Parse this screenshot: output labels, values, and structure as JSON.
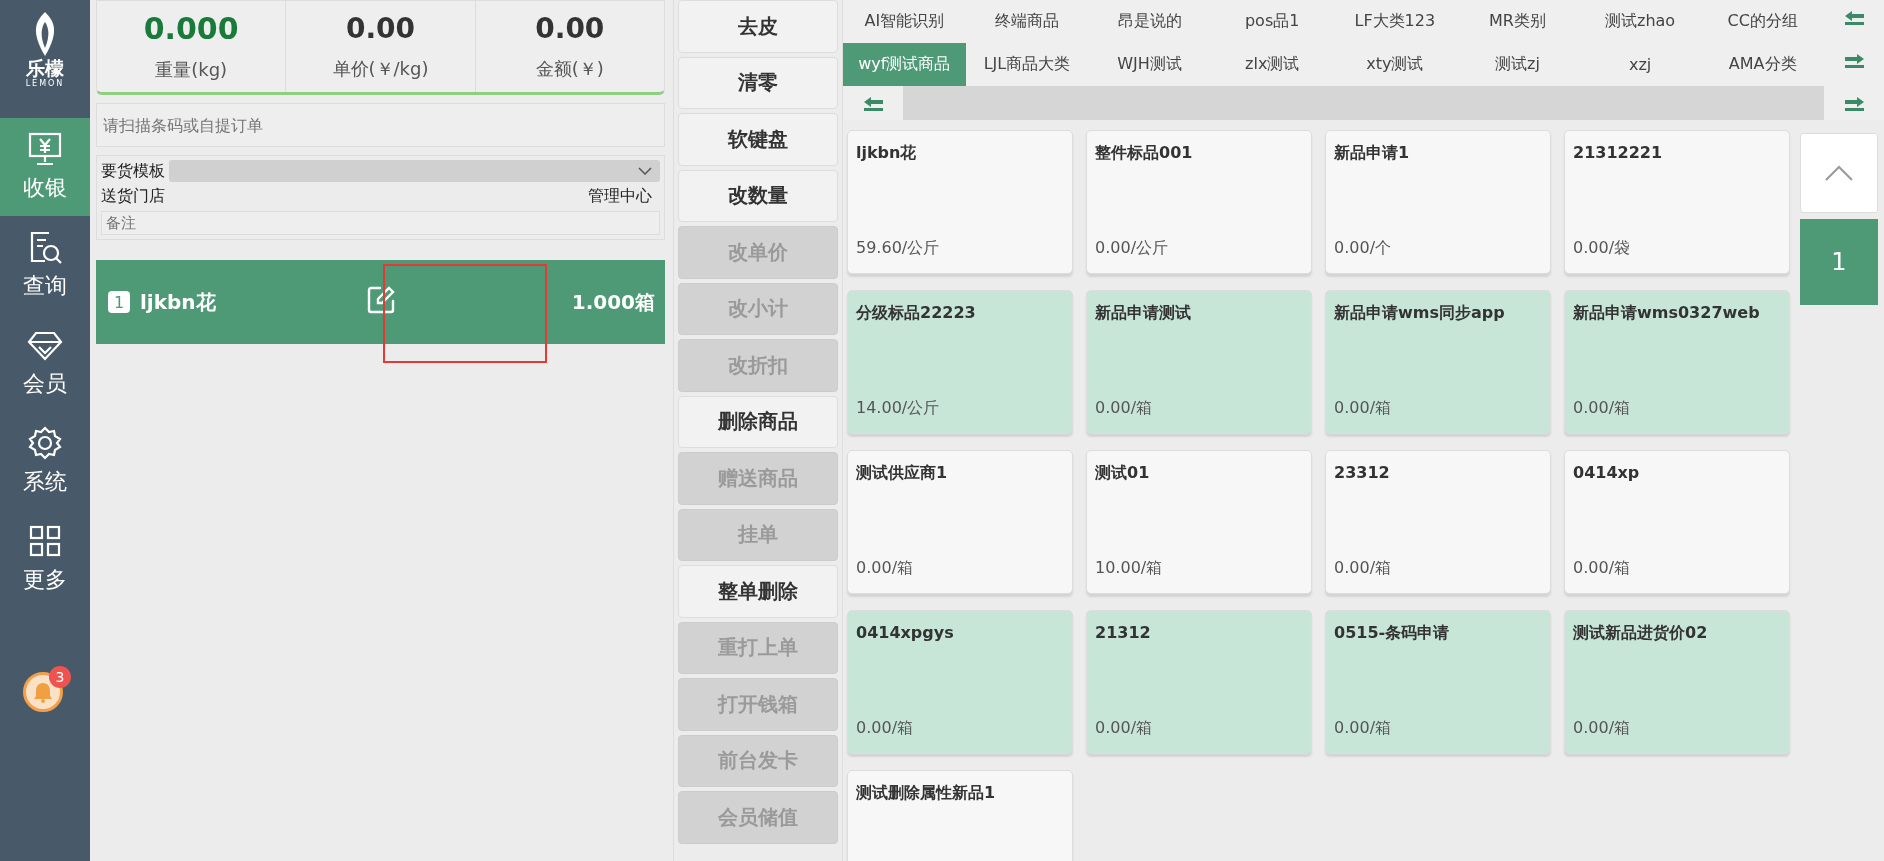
{
  "sidebar": {
    "logo": {
      "name": "乐檬",
      "subtitle": "LEMON"
    },
    "items": [
      {
        "label": "收银",
        "kind": "register",
        "selected": true
      },
      {
        "label": "查询",
        "kind": "search",
        "selected": false
      },
      {
        "label": "会员",
        "kind": "diamond",
        "selected": false
      },
      {
        "label": "系统",
        "kind": "gear",
        "selected": false
      },
      {
        "label": "更多",
        "kind": "grid",
        "selected": false
      }
    ],
    "notification": {
      "count": "3"
    }
  },
  "readings": [
    {
      "value": "0.000",
      "label": "重量(kg)",
      "kind": "weight"
    },
    {
      "value": "0.00",
      "label": "单价(￥/kg)",
      "kind": "plain"
    },
    {
      "value": "0.00",
      "label": "金额(￥)",
      "kind": "plain"
    }
  ],
  "scan": {
    "placeholder": "请扫描条码或自提订单"
  },
  "order_form": {
    "template_label": "要货模板",
    "store_label": "送货门店",
    "store_value": "管理中心",
    "note": {
      "placeholder": "备注"
    }
  },
  "order_lines": [
    {
      "index": "1",
      "name": "ljkbn花",
      "quantity": "1.000箱",
      "highlighted": true
    }
  ],
  "actions": [
    {
      "label": "去皮",
      "disabled": false
    },
    {
      "label": "清零",
      "disabled": false
    },
    {
      "label": "软键盘",
      "disabled": false
    },
    {
      "label": "改数量",
      "disabled": false
    },
    {
      "label": "改单价",
      "disabled": true
    },
    {
      "label": "改小计",
      "disabled": true
    },
    {
      "label": "改折扣",
      "disabled": true
    },
    {
      "label": "删除商品",
      "disabled": false
    },
    {
      "label": "赠送商品",
      "disabled": true
    },
    {
      "label": "挂单",
      "disabled": true
    },
    {
      "label": "整单删除",
      "disabled": false
    },
    {
      "label": "重打上单",
      "disabled": true
    },
    {
      "label": "打开钱箱",
      "disabled": true
    },
    {
      "label": "前台发卡",
      "disabled": true
    },
    {
      "label": "会员储值",
      "disabled": true
    }
  ],
  "categories": [
    {
      "label": "AI智能识别",
      "selected": false
    },
    {
      "label": "终端商品",
      "selected": false
    },
    {
      "label": "昂是说的",
      "selected": false
    },
    {
      "label": "pos品1",
      "selected": false
    },
    {
      "label": "LF大类123",
      "selected": false
    },
    {
      "label": "MR类别",
      "selected": false
    },
    {
      "label": "测试zhao",
      "selected": false
    },
    {
      "label": "CC的分组",
      "selected": false
    },
    {
      "label": "wyf测试商品",
      "selected": true
    },
    {
      "label": "LJL商品大类",
      "selected": false
    },
    {
      "label": "WJH测试",
      "selected": false
    },
    {
      "label": "zlx测试",
      "selected": false
    },
    {
      "label": "xty测试",
      "selected": false
    },
    {
      "label": "测试zj",
      "selected": false
    },
    {
      "label": "xzj",
      "selected": false
    },
    {
      "label": "AMA分类",
      "selected": false
    }
  ],
  "products": [
    {
      "name": "ljkbn花",
      "price": "59.60/公斤",
      "color": "#f7f7f7"
    },
    {
      "name": "整件标品001",
      "price": "0.00/公斤",
      "color": "#f7f7f7"
    },
    {
      "name": "新品申请1",
      "price": "0.00/个",
      "color": "#f7f7f7"
    },
    {
      "name": "21312221",
      "price": "0.00/袋",
      "color": "#f7f7f7"
    },
    {
      "name": "分级标品22223",
      "price": "14.00/公斤",
      "color": "#c8e6d8"
    },
    {
      "name": "新品申请测试",
      "price": "0.00/箱",
      "color": "#c8e6d8"
    },
    {
      "name": "新品申请wms同步app",
      "price": "0.00/箱",
      "color": "#c8e6d8"
    },
    {
      "name": "新品申请wms0327web",
      "price": "0.00/箱",
      "color": "#c8e6d8"
    },
    {
      "name": "测试供应商1",
      "price": "0.00/箱",
      "color": "#f7f7f7"
    },
    {
      "name": "测试01",
      "price": "10.00/箱",
      "color": "#f7f7f7"
    },
    {
      "name": "23312",
      "price": "0.00/箱",
      "color": "#f7f7f7"
    },
    {
      "name": "0414xp",
      "price": "0.00/箱",
      "color": "#f7f7f7"
    },
    {
      "name": "0414xpgys",
      "price": "0.00/箱",
      "color": "#c8e6d8"
    },
    {
      "name": "21312",
      "price": "0.00/箱",
      "color": "#c8e6d8"
    },
    {
      "name": "0515-条码申请",
      "price": "0.00/箱",
      "color": "#c8e6d8"
    },
    {
      "name": "测试新品进货价02",
      "price": "0.00/箱",
      "color": "#c8e6d8"
    },
    {
      "name": "测试删除属性新品1",
      "color": "#f7f7f7"
    }
  ],
  "pager": {
    "pages": [
      {
        "label": "1",
        "selected": true
      }
    ]
  }
}
